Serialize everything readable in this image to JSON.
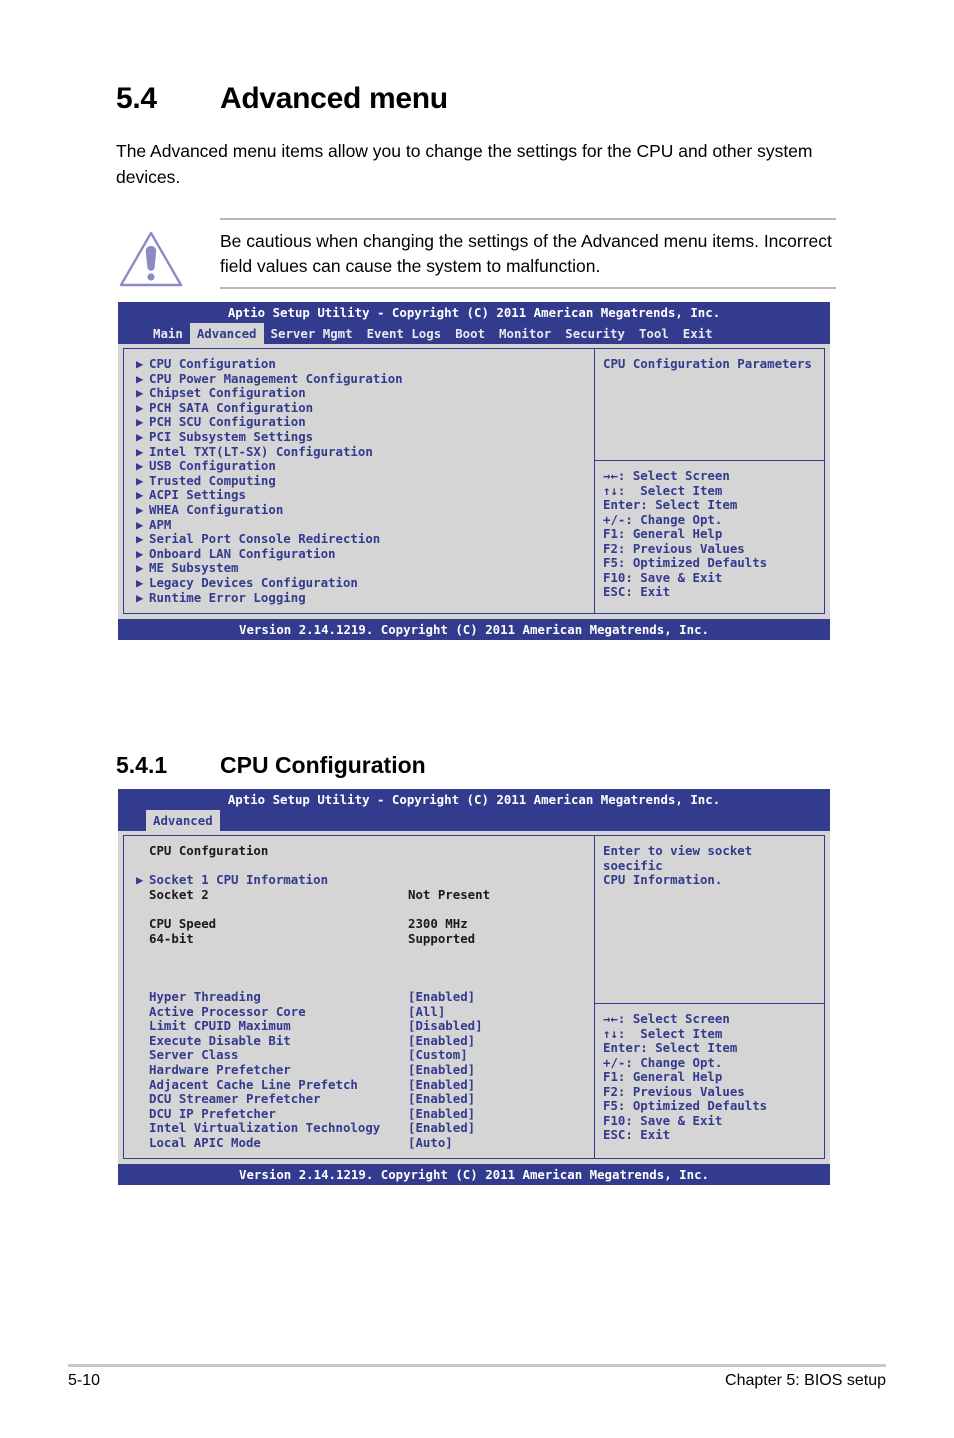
{
  "document": {
    "section_number": "5.4",
    "section_title": "Advanced menu",
    "intro": "The Advanced menu items allow you to change the settings for the CPU and other system devices.",
    "notice_text": "Be cautious when changing the settings of the Advanced menu items. Incorrect field values can cause the system to malfunction.",
    "notice_icon": "warning-triangle-icon",
    "subsection_number": "5.4.1",
    "subsection_title": "CPU Configuration",
    "footer_page": "5-10",
    "footer_chapter": "Chapter 5: BIOS setup"
  },
  "colors": {
    "bios_blue": "#333b8e",
    "bios_gray": "#d5d5d5",
    "notice_icon_purple": "#8a8ac4"
  },
  "bios_advanced": {
    "title": "Aptio Setup Utility - Copyright (C) 2011 American Megatrends, Inc.",
    "tabs": [
      {
        "label": "Main",
        "active": false
      },
      {
        "label": "Advanced",
        "active": true
      },
      {
        "label": "Server Mgmt",
        "active": false
      },
      {
        "label": "Event Logs",
        "active": false
      },
      {
        "label": "Boot",
        "active": false
      },
      {
        "label": "Monitor",
        "active": false
      },
      {
        "label": "Security",
        "active": false
      },
      {
        "label": "Tool",
        "active": false
      },
      {
        "label": "Exit",
        "active": false
      }
    ],
    "menu_items": [
      "CPU Configuration",
      "CPU Power Management Configuration",
      "Chipset Configuration",
      "PCH SATA Configuration",
      "PCH SCU Configuration",
      "PCI Subsystem Settings",
      "Intel TXT(LT-SX) Configuration",
      "USB Configuration",
      "Trusted Computing",
      "ACPI Settings",
      "WHEA Configuration",
      "APM",
      "Serial Port Console Redirection",
      "Onboard LAN Configuration",
      "ME Subsystem",
      "Legacy Devices Configuration",
      "Runtime Error Logging"
    ],
    "help_text": "CPU Configuration Parameters",
    "nav_keys": [
      "→←: Select Screen",
      "↑↓:  Select Item",
      "Enter: Select Item",
      "+/-: Change Opt.",
      "F1: General Help",
      "F2: Previous Values",
      "F5: Optimized Defaults",
      "F10: Save & Exit",
      "ESC: Exit"
    ],
    "footer": "Version 2.14.1219. Copyright (C) 2011 American Megatrends, Inc."
  },
  "bios_cpu": {
    "title": "Aptio Setup Utility - Copyright (C) 2011 American Megatrends, Inc.",
    "tabs": [
      {
        "label": "Advanced",
        "active": true
      }
    ],
    "heading": "CPU Confguration",
    "rows": [
      {
        "type": "spacer"
      },
      {
        "type": "link",
        "label": "Socket 1 CPU Information",
        "value": ""
      },
      {
        "type": "info",
        "label": "Socket 2",
        "value": "Not Present"
      },
      {
        "type": "spacer"
      },
      {
        "type": "info",
        "label": "CPU Speed",
        "value": "2300 MHz"
      },
      {
        "type": "info",
        "label": "64-bit",
        "value": "Supported"
      },
      {
        "type": "spacer"
      },
      {
        "type": "spacer"
      },
      {
        "type": "spacer"
      },
      {
        "type": "opt",
        "label": "Hyper Threading",
        "value": "[Enabled]"
      },
      {
        "type": "opt",
        "label": "Active Processor Core",
        "value": "[All]"
      },
      {
        "type": "opt",
        "label": "Limit CPUID Maximum",
        "value": "[Disabled]"
      },
      {
        "type": "opt",
        "label": "Execute Disable Bit",
        "value": "[Enabled]"
      },
      {
        "type": "opt",
        "label": "Server Class",
        "value": "[Custom]"
      },
      {
        "type": "opt",
        "label": "Hardware Prefetcher",
        "value": "[Enabled]"
      },
      {
        "type": "opt",
        "label": "Adjacent Cache Line Prefetch",
        "value": "[Enabled]"
      },
      {
        "type": "opt",
        "label": "DCU Streamer Prefetcher",
        "value": "[Enabled]"
      },
      {
        "type": "opt",
        "label": "DCU IP Prefetcher",
        "value": "[Enabled]"
      },
      {
        "type": "opt",
        "label": "Intel Virtualization Technology",
        "value": "[Enabled]"
      },
      {
        "type": "opt",
        "label": "Local APIC Mode",
        "value": "[Auto]"
      }
    ],
    "help_text": "Enter to view socket soecific\nCPU Information.",
    "nav_keys": [
      "→←: Select Screen",
      "↑↓:  Select Item",
      "Enter: Select Item",
      "+/-: Change Opt.",
      "F1: General Help",
      "F2: Previous Values",
      "F5: Optimized Defaults",
      "F10: Save & Exit",
      "ESC: Exit"
    ],
    "footer": "Version 2.14.1219. Copyright (C) 2011 American Megatrends, Inc."
  }
}
